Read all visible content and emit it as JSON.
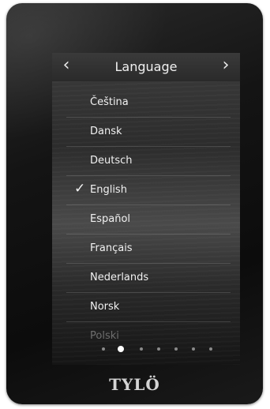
{
  "header": {
    "prev_icon": "‹",
    "next_icon": "›",
    "title": "Language"
  },
  "languages": [
    {
      "label": "Čeština",
      "selected": false
    },
    {
      "label": "Dansk",
      "selected": false
    },
    {
      "label": "Deutsch",
      "selected": false
    },
    {
      "label": "English",
      "selected": true
    },
    {
      "label": "Español",
      "selected": false
    },
    {
      "label": "Français",
      "selected": false
    },
    {
      "label": "Nederlands",
      "selected": false
    },
    {
      "label": "Norsk",
      "selected": false
    },
    {
      "label": "Polski",
      "selected": false
    }
  ],
  "check_icon": "✓",
  "pagination": {
    "count": 7,
    "active_index": 1
  },
  "brand": {
    "logo_text": "TYLÖ"
  },
  "colors": {
    "selected_check": "#f4f4f4",
    "text": "#f1f1f1"
  }
}
